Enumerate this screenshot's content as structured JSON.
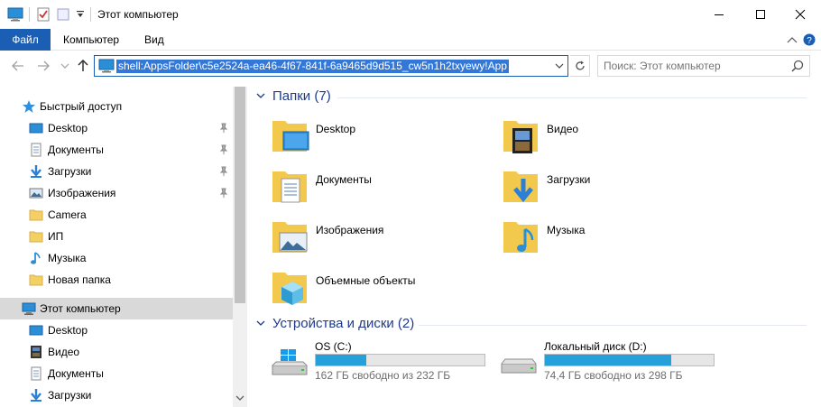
{
  "window": {
    "title": "Этот компьютер",
    "minimize_icon": "minimize-icon",
    "maximize_icon": "maximize-icon",
    "close_icon": "close-icon"
  },
  "ribbon": {
    "tabs": [
      "Файл",
      "Компьютер",
      "Вид"
    ],
    "accent": "#1a5fb4"
  },
  "address": {
    "path": "shell:AppsFolder\\c5e2524a-ea46-4f67-841f-6a9465d9d515_cw5n1h2txyewy!App",
    "search_placeholder": "Поиск: Этот компьютер"
  },
  "nav_pane": {
    "quick_access": {
      "label": "Быстрый доступ",
      "items": [
        {
          "label": "Desktop",
          "icon": "desktop-icon",
          "pinned": true
        },
        {
          "label": "Документы",
          "icon": "documents-icon",
          "pinned": true
        },
        {
          "label": "Загрузки",
          "icon": "downloads-icon",
          "pinned": true
        },
        {
          "label": "Изображения",
          "icon": "pictures-icon",
          "pinned": true
        },
        {
          "label": "Camera",
          "icon": "folder-icon",
          "pinned": false
        },
        {
          "label": "ИП",
          "icon": "folder-icon",
          "pinned": false
        },
        {
          "label": "Музыка",
          "icon": "music-icon",
          "pinned": false
        },
        {
          "label": "Новая папка",
          "icon": "folder-icon",
          "pinned": false
        }
      ]
    },
    "this_pc": {
      "label": "Этот компьютер",
      "items": [
        {
          "label": "Desktop",
          "icon": "desktop-icon"
        },
        {
          "label": "Видео",
          "icon": "videos-icon"
        },
        {
          "label": "Документы",
          "icon": "documents-icon"
        },
        {
          "label": "Загрузки",
          "icon": "downloads-icon"
        }
      ]
    }
  },
  "content": {
    "folders_group": {
      "title": "Папки (7)",
      "items": [
        {
          "label": "Desktop",
          "icon": "desktop-folder-icon"
        },
        {
          "label": "Видео",
          "icon": "videos-folder-icon"
        },
        {
          "label": "Документы",
          "icon": "documents-folder-icon"
        },
        {
          "label": "Загрузки",
          "icon": "downloads-folder-icon"
        },
        {
          "label": "Изображения",
          "icon": "pictures-folder-icon"
        },
        {
          "label": "Музыка",
          "icon": "music-folder-icon"
        },
        {
          "label": "Объемные объекты",
          "icon": "3d-objects-folder-icon"
        }
      ]
    },
    "drives_group": {
      "title": "Устройства и диски (2)",
      "items": [
        {
          "label": "OS (C:)",
          "free_text": "162 ГБ свободно из 232 ГБ",
          "used_fraction": 0.302,
          "icon": "windows-drive-icon"
        },
        {
          "label": "Локальный диск (D:)",
          "free_text": "74,4 ГБ свободно из 298 ГБ",
          "used_fraction": 0.75,
          "icon": "hard-drive-icon"
        }
      ]
    }
  }
}
